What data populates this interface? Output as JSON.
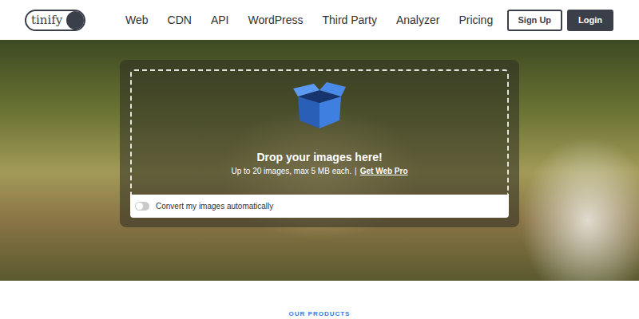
{
  "logo": {
    "text": "tinify"
  },
  "nav": {
    "items": [
      "Web",
      "CDN",
      "API",
      "WordPress",
      "Third Party",
      "Analyzer",
      "Pricing"
    ]
  },
  "auth": {
    "buttons": [
      {
        "label": "Sign Up",
        "kind": "outline"
      },
      {
        "label": "Login",
        "kind": "filled"
      }
    ]
  },
  "dropzone": {
    "title": "Drop your images here!",
    "subtitle": "Up to 20 images, max 5 MB each.",
    "separator": "|",
    "link": "Get Web Pro"
  },
  "convert": {
    "label": "Convert my images automatically",
    "on": false
  },
  "section": {
    "eyebrow": "OUR PRODUCTS"
  }
}
